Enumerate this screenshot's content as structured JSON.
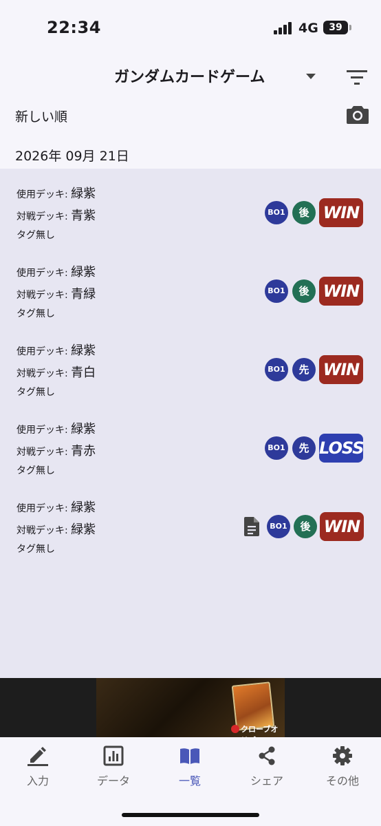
{
  "status": {
    "time": "22:34",
    "network": "4G",
    "battery": "39",
    "battery_level_pct": 39
  },
  "header": {
    "title": "ガンダムカードゲーム"
  },
  "sort": {
    "label": "新しい順"
  },
  "date": "2026年 09月 21日",
  "labels": {
    "used_deck": "使用デッキ: ",
    "opponent_deck": "対戦デッキ: "
  },
  "matches": [
    {
      "used": "緑紫",
      "opponent": "青紫",
      "tags": "タグ無し",
      "format": "BO1",
      "turn": "後",
      "result": "WIN",
      "has_note": false
    },
    {
      "used": "緑紫",
      "opponent": "青緑",
      "tags": "タグ無し",
      "format": "BO1",
      "turn": "後",
      "result": "WIN",
      "has_note": false
    },
    {
      "used": "緑紫",
      "opponent": "青白",
      "tags": "タグ無し",
      "format": "BO1",
      "turn": "先",
      "result": "WIN",
      "has_note": false
    },
    {
      "used": "緑紫",
      "opponent": "青赤",
      "tags": "タグ無し",
      "format": "BO1",
      "turn": "先",
      "result": "LOSS",
      "has_note": false
    },
    {
      "used": "緑紫",
      "opponent": "緑紫",
      "tags": "タグ無し",
      "format": "BO1",
      "turn": "後",
      "result": "WIN",
      "has_note": true
    }
  ],
  "ad": {
    "brand": "クローブオリパ"
  },
  "nav": {
    "items": [
      {
        "label": "入力",
        "icon": "pencil-icon"
      },
      {
        "label": "データ",
        "icon": "chart-icon"
      },
      {
        "label": "一覧",
        "icon": "book-icon",
        "active": true
      },
      {
        "label": "シェア",
        "icon": "share-icon"
      },
      {
        "label": "その他",
        "icon": "gear-icon"
      }
    ]
  },
  "colors": {
    "win": "#9c2a20",
    "loss": "#2e3fb0",
    "bo1": "#2e3a9a",
    "turn_go": "#237055",
    "turn_first": "#2e3a9a",
    "accent": "#4a58b8"
  }
}
